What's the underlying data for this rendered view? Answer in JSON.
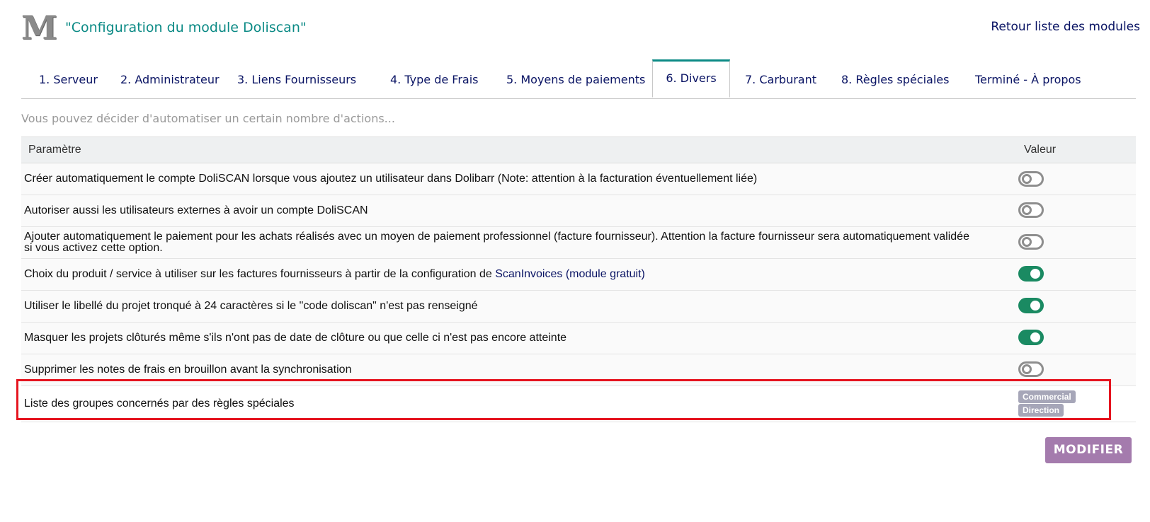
{
  "header": {
    "logo": "M",
    "title": "\"Configuration du module Doliscan\"",
    "back_link": "Retour liste des modules"
  },
  "tabs": [
    {
      "label": "1. Serveur"
    },
    {
      "label": "2. Administrateur"
    },
    {
      "label": "3. Liens Fournisseurs"
    },
    {
      "label": "4. Type de Frais"
    },
    {
      "label": "5. Moyens de paiements"
    },
    {
      "label": "6. Divers",
      "active": true
    },
    {
      "label": "7. Carburant"
    },
    {
      "label": "8. Règles spéciales"
    },
    {
      "label": "Terminé - À propos"
    }
  ],
  "description": "Vous pouvez décider d'automatiser un certain nombre d'actions...",
  "table": {
    "headers": {
      "param": "Paramètre",
      "value": "Valeur"
    },
    "rows": [
      {
        "label": "Créer automatiquement le compte DoliSCAN lorsque vous ajoutez un utilisateur dans Dolibarr (Note: attention à la facturation éventuellement liée)",
        "state": "off"
      },
      {
        "label": "Autoriser aussi les utilisateurs externes à avoir un compte DoliSCAN",
        "state": "off"
      },
      {
        "label": "Ajouter automatiquement le paiement pour les achats réalisés avec un moyen de paiement professionnel (facture fournisseur). Attention la facture fournisseur sera automatiquement validée si vous activez cette option.",
        "state": "off"
      },
      {
        "label": "Choix du produit / service à utiliser sur les factures fournisseurs à partir de la configuration de ",
        "link": "ScanInvoices (module gratuit)",
        "state": "on"
      },
      {
        "label": "Utiliser le libellé du projet tronqué à 24 caractères si le \"code doliscan\" n'est pas renseigné",
        "state": "on"
      },
      {
        "label": "Masquer les projets clôturés même s'ils n'ont pas de date de clôture ou que celle ci n'est pas encore atteinte",
        "state": "on"
      },
      {
        "label": "Supprimer les notes de frais en brouillon avant la synchronisation",
        "state": "off"
      },
      {
        "label": "Liste des groupes concernés par des règles spéciales",
        "tags": [
          "Commercial",
          "Direction"
        ]
      }
    ]
  },
  "buttons": {
    "modify": "MODIFIER"
  },
  "colors": {
    "accent": "#0b8a85",
    "toggle_on": "#1a8a62",
    "button": "#a47bad",
    "highlight": "#e5141f"
  }
}
